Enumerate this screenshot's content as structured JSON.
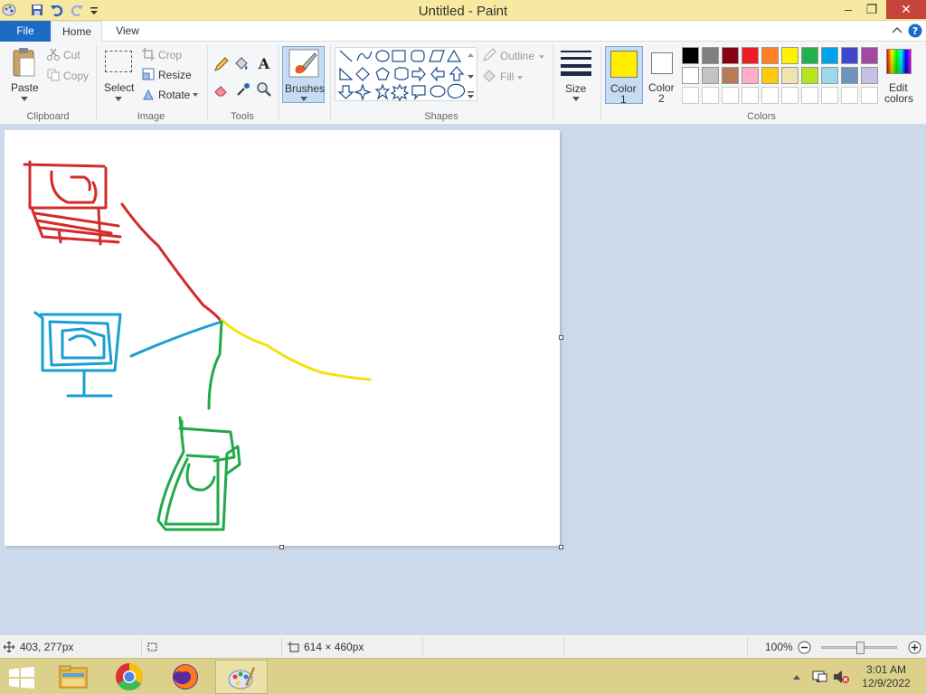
{
  "window": {
    "title": "Untitled - Paint"
  },
  "tabs": {
    "file": "File",
    "home": "Home",
    "view": "View"
  },
  "clipboard": {
    "paste": "Paste",
    "cut": "Cut",
    "copy": "Copy",
    "group": "Clipboard"
  },
  "image": {
    "select": "Select",
    "crop": "Crop",
    "resize": "Resize",
    "rotate": "Rotate",
    "group": "Image"
  },
  "tools": {
    "group": "Tools"
  },
  "brushes": {
    "label": "Brushes"
  },
  "shapes": {
    "outline": "Outline",
    "fill": "Fill",
    "group": "Shapes"
  },
  "size": {
    "label": "Size"
  },
  "colors": {
    "color1_label": "Color",
    "color1_num": "1",
    "color2_label": "Color",
    "color2_num": "2",
    "color1": "#ffee00",
    "color2": "#ffffff",
    "edit_label": "Edit",
    "edit_label2": "colors",
    "group": "Colors",
    "row1": [
      "#000000",
      "#7f7f7f",
      "#880015",
      "#ed1c24",
      "#ff7f27",
      "#fff200",
      "#22b14c",
      "#00a2e8",
      "#3f48cc",
      "#a349a4"
    ],
    "row2": [
      "#ffffff",
      "#c3c3c3",
      "#b97a57",
      "#ffaec9",
      "#ffc90e",
      "#efe4b0",
      "#b5e61d",
      "#99d9ea",
      "#7092be",
      "#c8bfe7"
    ]
  },
  "status": {
    "cursor_pos": "403, 277px",
    "canvas_size": "614 × 460px",
    "zoom": "100%",
    "zoom_fraction": 0.5
  },
  "taskbar": {
    "time": "3:01 AM",
    "date": "12/9/2022"
  }
}
